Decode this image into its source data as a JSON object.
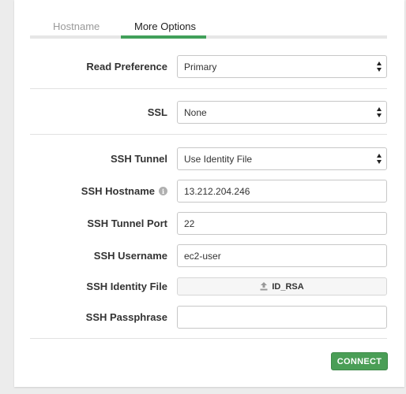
{
  "tabs": {
    "hostname_label": "Hostname",
    "more_options_label": "More Options"
  },
  "read_preference": {
    "label": "Read Preference",
    "value": "Primary"
  },
  "ssl": {
    "label": "SSL",
    "value": "None"
  },
  "ssh_tunnel": {
    "label": "SSH Tunnel",
    "value": "Use Identity File"
  },
  "ssh_hostname": {
    "label": "SSH Hostname",
    "value": "13.212.204.246",
    "info_icon": "i"
  },
  "ssh_tunnel_port": {
    "label": "SSH Tunnel Port",
    "value": "22"
  },
  "ssh_username": {
    "label": "SSH Username",
    "value": "ec2-user"
  },
  "ssh_identity_file": {
    "label": "SSH Identity File",
    "button_label": "ID_RSA",
    "icon": "upload-icon"
  },
  "ssh_passphrase": {
    "label": "SSH Passphrase",
    "value": ""
  },
  "actions": {
    "connect_label": "CONNECT"
  },
  "colors": {
    "accent": "#41a05a",
    "connect": "#4a9e56",
    "background": "#ececec"
  }
}
